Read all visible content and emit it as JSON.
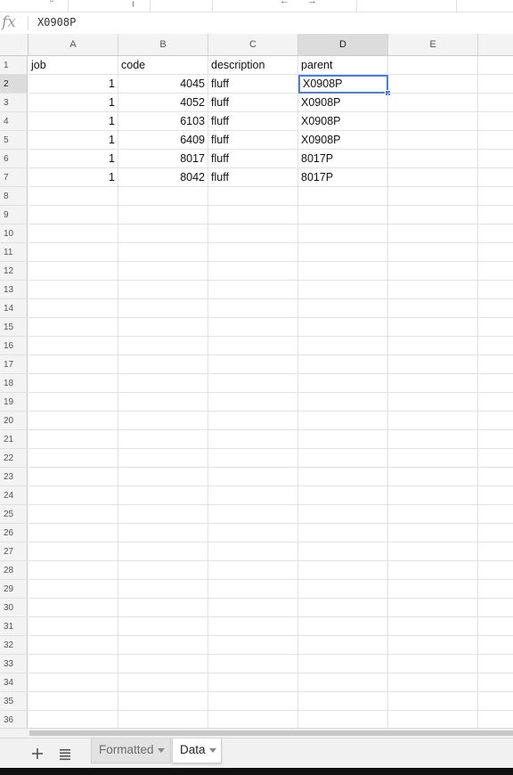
{
  "formula_bar": {
    "fx_label": "fx",
    "value": "X0908P"
  },
  "columns": [
    "A",
    "B",
    "C",
    "D",
    "E"
  ],
  "selected_column": "D",
  "selected_row": "2",
  "rows": [
    {
      "n": "1",
      "cells": [
        "job",
        "code",
        "description",
        "parent",
        ""
      ]
    },
    {
      "n": "2",
      "cells": [
        "1",
        "4045",
        "fluff",
        "X0908P",
        ""
      ]
    },
    {
      "n": "3",
      "cells": [
        "1",
        "4052",
        "fluff",
        "X0908P",
        ""
      ]
    },
    {
      "n": "4",
      "cells": [
        "1",
        "6103",
        "fluff",
        "X0908P",
        ""
      ]
    },
    {
      "n": "5",
      "cells": [
        "1",
        "6409",
        "fluff",
        "X0908P",
        ""
      ]
    },
    {
      "n": "6",
      "cells": [
        "1",
        "8017",
        "fluff",
        "8017P",
        ""
      ]
    },
    {
      "n": "7",
      "cells": [
        "1",
        "8042",
        "fluff",
        "8017P",
        ""
      ]
    },
    {
      "n": "8",
      "cells": [
        "",
        "",
        "",
        "",
        ""
      ]
    },
    {
      "n": "9",
      "cells": [
        "",
        "",
        "",
        "",
        ""
      ]
    },
    {
      "n": "10",
      "cells": [
        "",
        "",
        "",
        "",
        ""
      ]
    },
    {
      "n": "11",
      "cells": [
        "",
        "",
        "",
        "",
        ""
      ]
    },
    {
      "n": "12",
      "cells": [
        "",
        "",
        "",
        "",
        ""
      ]
    },
    {
      "n": "13",
      "cells": [
        "",
        "",
        "",
        "",
        ""
      ]
    },
    {
      "n": "14",
      "cells": [
        "",
        "",
        "",
        "",
        ""
      ]
    },
    {
      "n": "15",
      "cells": [
        "",
        "",
        "",
        "",
        ""
      ]
    },
    {
      "n": "16",
      "cells": [
        "",
        "",
        "",
        "",
        ""
      ]
    },
    {
      "n": "17",
      "cells": [
        "",
        "",
        "",
        "",
        ""
      ]
    },
    {
      "n": "18",
      "cells": [
        "",
        "",
        "",
        "",
        ""
      ]
    },
    {
      "n": "19",
      "cells": [
        "",
        "",
        "",
        "",
        ""
      ]
    },
    {
      "n": "20",
      "cells": [
        "",
        "",
        "",
        "",
        ""
      ]
    },
    {
      "n": "21",
      "cells": [
        "",
        "",
        "",
        "",
        ""
      ]
    },
    {
      "n": "22",
      "cells": [
        "",
        "",
        "",
        "",
        ""
      ]
    },
    {
      "n": "23",
      "cells": [
        "",
        "",
        "",
        "",
        ""
      ]
    },
    {
      "n": "24",
      "cells": [
        "",
        "",
        "",
        "",
        ""
      ]
    },
    {
      "n": "25",
      "cells": [
        "",
        "",
        "",
        "",
        ""
      ]
    },
    {
      "n": "26",
      "cells": [
        "",
        "",
        "",
        "",
        ""
      ]
    },
    {
      "n": "27",
      "cells": [
        "",
        "",
        "",
        "",
        ""
      ]
    },
    {
      "n": "28",
      "cells": [
        "",
        "",
        "",
        "",
        ""
      ]
    },
    {
      "n": "29",
      "cells": [
        "",
        "",
        "",
        "",
        ""
      ]
    },
    {
      "n": "30",
      "cells": [
        "",
        "",
        "",
        "",
        ""
      ]
    },
    {
      "n": "31",
      "cells": [
        "",
        "",
        "",
        "",
        ""
      ]
    },
    {
      "n": "32",
      "cells": [
        "",
        "",
        "",
        "",
        ""
      ]
    },
    {
      "n": "33",
      "cells": [
        "",
        "",
        "",
        "",
        ""
      ]
    },
    {
      "n": "34",
      "cells": [
        "",
        "",
        "",
        "",
        ""
      ]
    },
    {
      "n": "35",
      "cells": [
        "",
        "",
        "",
        "",
        ""
      ]
    },
    {
      "n": "36",
      "cells": [
        "",
        "",
        "",
        "",
        ""
      ]
    }
  ],
  "sheet_tabs": {
    "add_icon": "plus-icon",
    "list_icon": "list-icon",
    "tabs": [
      {
        "label": "Formatted",
        "active": false
      },
      {
        "label": "Data",
        "active": true
      }
    ]
  },
  "colors": {
    "selection": "#4a7ee3",
    "header_bg": "#f3f3f3",
    "selected_header_bg": "#dcdcdc"
  }
}
